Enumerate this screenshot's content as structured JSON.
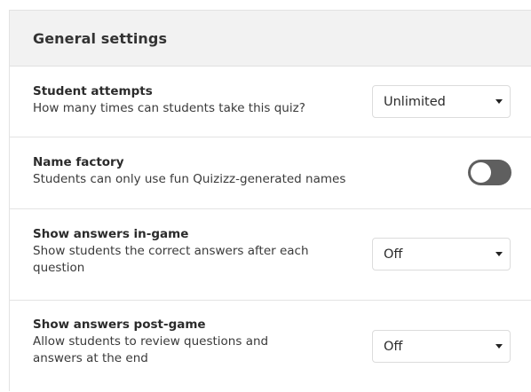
{
  "panel": {
    "title": "General settings"
  },
  "settings": [
    {
      "title": "Student attempts",
      "description": "How many times can students take this quiz?",
      "control": "select",
      "value": "Unlimited"
    },
    {
      "title": "Name factory",
      "description": "Students can only use fun Quizizz-generated names",
      "control": "toggle",
      "enabled": false
    },
    {
      "title": "Show answers in-game",
      "description_lines": [
        "Show students the correct answers after each",
        "question"
      ],
      "control": "select",
      "value": "Off"
    },
    {
      "title": "Show answers post-game",
      "description_lines": [
        "Allow students to review questions and",
        "answers at the end"
      ],
      "control": "select",
      "value": "Off"
    }
  ],
  "icons": {
    "dropdown": "caret-down-icon"
  },
  "colors": {
    "header_bg": "#f2f2f2",
    "toggle_off": "#5f5f5f"
  }
}
